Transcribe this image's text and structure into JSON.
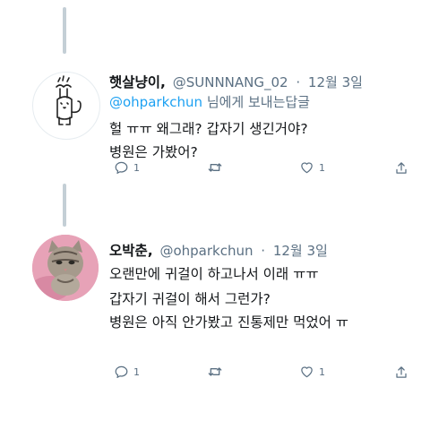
{
  "tweet1": {
    "display_name": "햇살냥이,",
    "handle": "@SUNNNANG_02",
    "separator": "·",
    "date": "12월 3일",
    "reply_to_handle": "@ohparkchun",
    "reply_to_suffix": "님에게 보내는답글",
    "lines": [
      "헐 ㅠㅠ 왜그래? 갑자기 생긴거야?",
      "병원은 가봤어?"
    ],
    "reply_count": "1",
    "retweet_count": "",
    "like_count": "1"
  },
  "tweet2": {
    "display_name": "오박춘,",
    "handle": "@ohparkchun",
    "separator": "·",
    "date": "12월 3일",
    "lines": [
      "오랜만에 귀걸이 하고나서 이래 ㅠㅠ",
      "갑자기 귀걸이 해서 그런가?",
      "병원은 아직 안가봤고 진통제만 먹었어 ㅠ"
    ],
    "reply_count": "1",
    "retweet_count": "",
    "like_count": "1"
  },
  "icons": [
    "reply-icon",
    "retweet-icon",
    "like-icon",
    "share-icon"
  ]
}
